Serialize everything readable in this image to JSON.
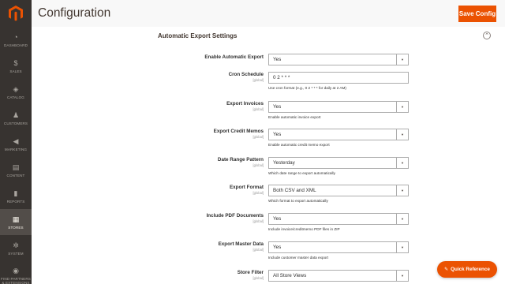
{
  "header": {
    "title": "Configuration",
    "save_label": "Save Config"
  },
  "sidebar": {
    "items": [
      {
        "label": "DASHBOARD",
        "icon": "dashboard-icon",
        "glyph": "◔",
        "active": false
      },
      {
        "label": "SALES",
        "icon": "dollar-icon",
        "glyph": "$",
        "active": false
      },
      {
        "label": "CATALOG",
        "icon": "box-icon",
        "glyph": "◈",
        "active": false
      },
      {
        "label": "CUSTOMERS",
        "icon": "person-icon",
        "glyph": "♟",
        "active": false
      },
      {
        "label": "MARKETING",
        "icon": "megaphone-icon",
        "glyph": "◀",
        "active": false
      },
      {
        "label": "CONTENT",
        "icon": "content-icon",
        "glyph": "▤",
        "active": false
      },
      {
        "label": "REPORTS",
        "icon": "bar-chart-icon",
        "glyph": "▮",
        "active": false
      },
      {
        "label": "STORES",
        "icon": "store-icon",
        "glyph": "▦",
        "active": true
      },
      {
        "label": "SYSTEM",
        "icon": "gear-icon",
        "glyph": "✲",
        "active": false
      },
      {
        "label": "FIND PARTNERS & EXTENSIONS",
        "icon": "puzzle-icon",
        "glyph": "◉",
        "active": false
      }
    ]
  },
  "section": {
    "title": "Automatic Export Settings"
  },
  "scope": "[global]",
  "fields": {
    "enable": {
      "label": "Enable Automatic Export",
      "value": "Yes"
    },
    "cron": {
      "label": "Cron Schedule",
      "value": "0 2 * * *",
      "note": "Use cron format (e.g., 0 2 * * * for daily at 2 AM)"
    },
    "invoices": {
      "label": "Export Invoices",
      "value": "Yes",
      "note": "Enable automatic invoice export"
    },
    "credit_memos": {
      "label": "Export Credit Memos",
      "value": "Yes",
      "note": "Enable automatic credit memo export"
    },
    "date_range": {
      "label": "Date Range Pattern",
      "value": "Yesterday",
      "note": "Which date range to export automatically"
    },
    "format": {
      "label": "Export Format",
      "value": "Both CSV and XML",
      "note": "Which format to export automatically"
    },
    "pdf": {
      "label": "Include PDF Documents",
      "value": "Yes",
      "note": "Include invoice/creditmemo PDF files in ZIP"
    },
    "master_data": {
      "label": "Export Master Data",
      "value": "Yes",
      "note": "Include customer master data export"
    },
    "store_filter": {
      "label": "Store Filter",
      "value": "All Store Views"
    }
  },
  "quick_reference": {
    "label": "Quick Reference",
    "icon": "book-icon"
  },
  "colors": {
    "accent": "#eb5202",
    "sidebar": "#373330",
    "sidebar_active": "#524d49"
  }
}
